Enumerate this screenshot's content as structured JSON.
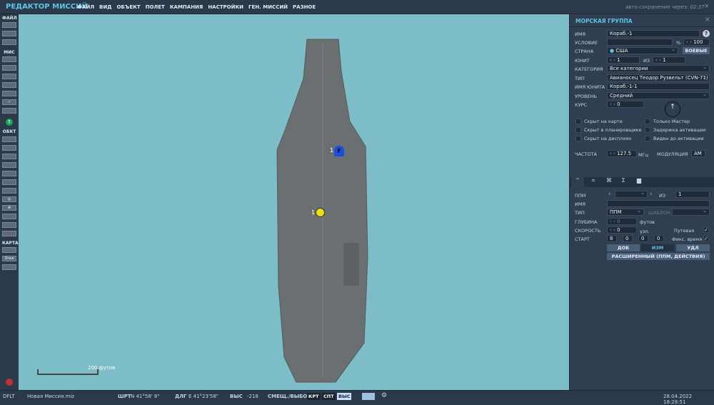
{
  "app": {
    "title": "РЕДАКТОР МИССИЙ",
    "menu": [
      "ФАЙЛ",
      "ВИД",
      "ОБЪЕКТ",
      "ПОЛЕТ",
      "КАМПАНИЯ",
      "НАСТРОЙКИ",
      "ГЕН. МИССИЙ",
      "РАЗНОЕ"
    ],
    "autosave": "авто-сохранение через:  02:37"
  },
  "toolbar": {
    "sections": {
      "file": "ФАЙЛ",
      "mis": "МИС",
      "obj": "ОБКТ",
      "map": "КАРТА"
    },
    "draw": "Draw"
  },
  "map": {
    "scale_label": "200 футов",
    "units": [
      {
        "label": "1",
        "symbol": "F",
        "color": "#1a4de6"
      },
      {
        "label": "1",
        "symbol": "",
        "color": "#f0e000"
      }
    ],
    "water_color": "#7dbdc7"
  },
  "panel": {
    "title": "МОРСКАЯ ГРУППА",
    "labels": {
      "name": "ИМЯ",
      "condition": "УСЛОВИЕ",
      "country": "СТРАНА",
      "unit": "ЮНИТ",
      "of": "ИЗ",
      "category": "КАТЕГОРИЯ",
      "type": "ТИП",
      "unit_name": "ИМЯ ЮНИТА",
      "skill": "УРОВЕНЬ",
      "heading": "КУРС",
      "freq": "ЧАСТОТА",
      "mhz": "МГц",
      "modulation": "МОДУЛЯЦИЯ",
      "percent": "%"
    },
    "values": {
      "name": "Кораб.-1",
      "condition": "",
      "probability": "100",
      "country": "США",
      "combat_button": "БОЕВЫЕ",
      "unit": "1",
      "unit_of": "1",
      "category": "Все категории",
      "type": "Авианосец Теодор Рузвельт (CVN-71)",
      "unit_name": "Кораб.-1-1",
      "skill": "Средний",
      "heading": "0",
      "freq": "127.5",
      "modulation": "AM"
    },
    "checkboxes": [
      {
        "label": "Скрыт на карте",
        "checked": false
      },
      {
        "label": "Только Мастер",
        "checked": false
      },
      {
        "label": "Скрыт в планировщике",
        "checked": false
      },
      {
        "label": "Задержка активации",
        "checked": false
      },
      {
        "label": "Скрыт на дисплеях",
        "checked": false
      },
      {
        "label": "Виден до активации",
        "checked": false
      }
    ],
    "tabs": [
      "route-icon",
      "target-icon",
      "payload-icon",
      "summary-icon",
      "airbase-icon"
    ],
    "waypoint": {
      "labels": {
        "wp": "ППМ",
        "of": "ИЗ",
        "name": "ИМЯ",
        "type": "ТИП",
        "template": "ШАБЛОН",
        "depth": "ГЛУБИНА",
        "feet": "футов",
        "speed": "СКОРОСТЬ",
        "knots": "узл.",
        "start": "СТАРТ",
        "route": "Путевая",
        "fixed_time": "Фикс. время"
      },
      "values": {
        "wp": "",
        "of": "1",
        "name": "",
        "type": "ППМ",
        "template": "",
        "depth": "0",
        "speed": "0",
        "start_h": "8",
        "start_m": "0",
        "start_s": "0",
        "start_d": "0",
        "route": true,
        "fixed_time": true
      },
      "buttons": {
        "add": "ДОБ",
        "edit": "ИЗМ",
        "delete": "УДЛ",
        "advanced": "РАСШИРЕННЫЙ (ППМ, ДЕЙСТВИЯ)"
      }
    }
  },
  "status": {
    "profile": "DFLT",
    "file": "Новая Миссия.miz",
    "lat_label": "ШРТ",
    "lat": "N 41°58' 8\"",
    "lon_label": "ДЛГ",
    "lon": "E 41°23'58\"",
    "alt_label": "ВЫС",
    "alt": "-218",
    "mode": "СМЕЩ./ВЫБОР",
    "b1": "КРТ",
    "b2": "СПТ",
    "b3": "ВЫС",
    "datetime": "28.04.2022 18:28:51"
  }
}
